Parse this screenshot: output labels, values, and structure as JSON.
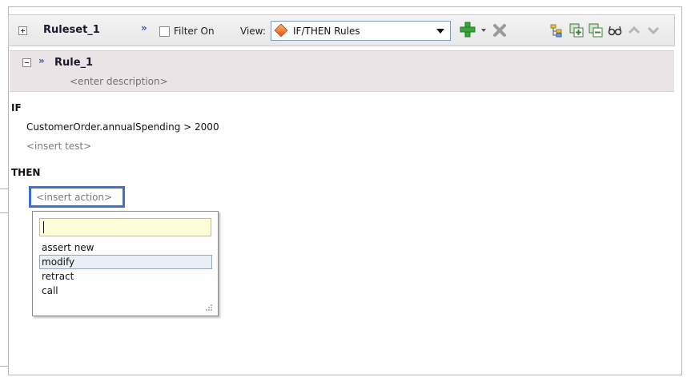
{
  "toolbar": {
    "ruleset_name": "Ruleset_1",
    "filter_label": "Filter On",
    "filter_checked": false,
    "view_label": "View:",
    "view_value": "IF/THEN Rules"
  },
  "rule": {
    "name": "Rule_1",
    "description_placeholder": "<enter description>"
  },
  "if_block": {
    "keyword": "IF",
    "condition": "CustomerOrder.annualSpending  >  2000",
    "insert_test": "<insert test>"
  },
  "then_block": {
    "keyword": "THEN",
    "insert_action": "<insert action>"
  },
  "action_popup": {
    "input_value": "",
    "items": [
      "assert new",
      "modify",
      "retract",
      "call"
    ],
    "selected": "modify"
  },
  "icons": {
    "accent_blue": "#3a6fd8",
    "add": "green-plus-icon",
    "delete": "gray-x-icon",
    "chevron": "blue-double-chevron-icon"
  }
}
